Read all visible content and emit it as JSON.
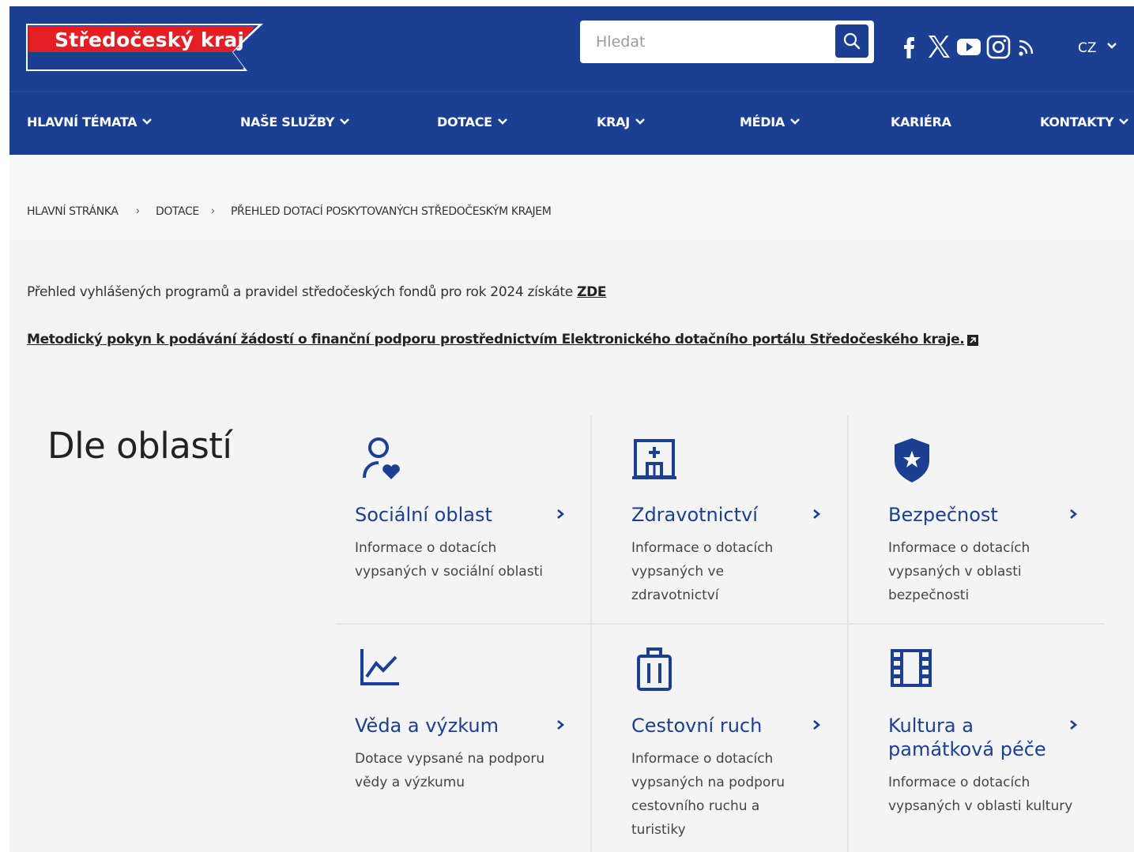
{
  "header": {
    "logo_text": "Středočeský kraj",
    "search_placeholder": "Hledat",
    "social": [
      "facebook-icon",
      "x-icon",
      "youtube-icon",
      "instagram-icon",
      "rss-icon"
    ],
    "language": "CZ",
    "colors": {
      "primary": "#1b3f93",
      "logo_red": "#e31e24"
    }
  },
  "nav": {
    "items": [
      {
        "label": "HLAVNÍ TÉMATA",
        "has_dropdown": true
      },
      {
        "label": "NAŠE SLUŽBY",
        "has_dropdown": true
      },
      {
        "label": "DOTACE",
        "has_dropdown": true
      },
      {
        "label": "KRAJ",
        "has_dropdown": true
      },
      {
        "label": "MÉDIA",
        "has_dropdown": true
      },
      {
        "label": "KARIÉRA",
        "has_dropdown": false
      },
      {
        "label": "KONTAKTY",
        "has_dropdown": true
      }
    ]
  },
  "breadcrumb": {
    "items": [
      "HLAVNÍ STRÁNKA",
      "DOTACE",
      "PŘEHLED DOTACÍ POSKYTOVANÝCH STŘEDOČESKÝM KRAJEM"
    ],
    "separator": "›"
  },
  "intro": {
    "text": "Přehled vyhlášených programů a pravidel středočeských fondů pro rok 2024 získáte ",
    "link": "ZDE"
  },
  "methodic_link": "Metodický pokyn k podávání žádostí o finanční podporu prostřednictvím Elektronického dotačního portálu Středočeského kraje.",
  "section": {
    "title": "Dle oblastí",
    "cards": [
      {
        "icon": "person-heart-icon",
        "title": "Sociální oblast",
        "desc": "Informace o dotacích vypsaných v sociální oblasti"
      },
      {
        "icon": "hospital-icon",
        "title": "Zdravotnictví",
        "desc": "Informace o dotacích vypsaných ve zdravotnictví"
      },
      {
        "icon": "shield-star-icon",
        "title": "Bezpečnost",
        "desc": "Informace o dotacích vypsaných v oblasti bezpečnosti"
      },
      {
        "icon": "line-chart-icon",
        "title": "Věda a výzkum",
        "desc": "Dotace vypsané na podporu vědy a výzkumu"
      },
      {
        "icon": "luggage-icon",
        "title": "Cestovní ruch",
        "desc": "Informace o dotacích vypsaných na podporu cestovního ruchu a turistiky"
      },
      {
        "icon": "film-icon",
        "title": "Kultura a památková péče",
        "desc": "Informace o dotacích vypsaných v oblasti kultury"
      }
    ]
  }
}
